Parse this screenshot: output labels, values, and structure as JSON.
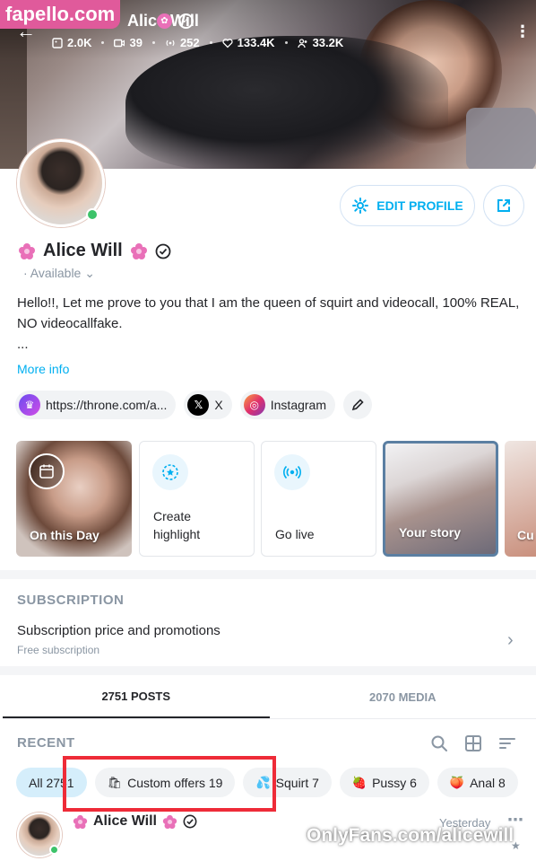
{
  "header": {
    "watermark": "fapello.com",
    "name": "Alice Will",
    "stats": [
      {
        "icon": "image-icon",
        "value": "2.0K"
      },
      {
        "icon": "video-icon",
        "value": "39"
      },
      {
        "icon": "live-icon",
        "value": "252"
      },
      {
        "icon": "heart-icon",
        "value": "133.4K"
      },
      {
        "icon": "fans-icon",
        "value": "33.2K"
      }
    ]
  },
  "profile": {
    "edit_label": "EDIT PROFILE",
    "name": "Alice Will",
    "availability": "Available",
    "bio": "Hello!!, Let me prove to you that I am the queen of squirt and videocall, 100% REAL, NO videocallfake.",
    "bio_more": "...",
    "more_info": "More info",
    "links": [
      {
        "icon": "throne-icon",
        "label": "https://throne.com/a..."
      },
      {
        "icon": "x-icon",
        "label": "X"
      },
      {
        "icon": "instagram-icon",
        "label": "Instagram"
      }
    ]
  },
  "highlights": [
    {
      "label": "On this Day"
    },
    {
      "label": "Create highlight"
    },
    {
      "label": "Go live"
    },
    {
      "label": "Your story"
    },
    {
      "label": "Cu"
    }
  ],
  "subscription": {
    "title": "SUBSCRIPTION",
    "row": "Subscription price and promotions",
    "sub": "Free subscription"
  },
  "tabs": [
    {
      "label": "2751 POSTS",
      "active": true
    },
    {
      "label": "2070 MEDIA",
      "active": false
    }
  ],
  "recent": {
    "title": "RECENT",
    "filters": [
      {
        "label": "All 2751",
        "active": true
      },
      {
        "emoji": "🛍",
        "label": "Custom offers 19"
      },
      {
        "emoji": "💦",
        "label": "Squirt 7"
      },
      {
        "emoji": "🍓",
        "label": "Pussy 6"
      },
      {
        "emoji": "🍑",
        "label": "Anal 8"
      }
    ]
  },
  "post": {
    "name": "Alice Will",
    "time": "Yesterday"
  },
  "watermark_bottom": "OnlyFans.com/alicewill",
  "colors": {
    "accent": "#00aff0",
    "muted": "#8a96a3",
    "online": "#3dc36a",
    "highlight_box": "#ee2b38",
    "fapello": "#e05a9b"
  }
}
